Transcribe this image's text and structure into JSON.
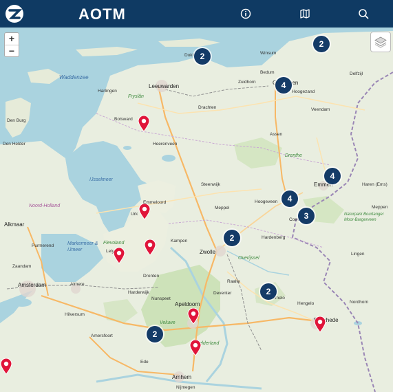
{
  "header": {
    "title": "AOTM",
    "icons": [
      "info-icon",
      "map-icon",
      "search-icon"
    ]
  },
  "map": {
    "zoom_in_label": "+",
    "zoom_out_label": "−",
    "water_labels": [
      "Waddenzee",
      "IJsselmeer",
      "Markermeer & IJmeer",
      "Noord-Holland"
    ],
    "green_labels": [
      "Fryslân",
      "Drenthe",
      "Flevoland",
      "Overijssel",
      "Veluwe",
      "Gelderland",
      "Naturpark Bourtanger Moor-Bargerveen"
    ],
    "place_labels": [
      "Den Burg",
      "Den Helder",
      "Dokkum",
      "Leeuwarden",
      "Harlingen",
      "Bolsward",
      "Heerenveen",
      "Drachten",
      "Groningen",
      "Hoogezand",
      "Veendam",
      "Assen",
      "Emmen",
      "Hoogeveen",
      "Meppel",
      "Steenwijk",
      "Emmeloord",
      "Urk",
      "Lelystad",
      "Dronten",
      "Kampen",
      "Zwolle",
      "Hardenberg",
      "Coevorden",
      "Almelo",
      "Hengelo",
      "Enschede",
      "Deventer",
      "Apeldoorn",
      "Amersfoort",
      "Amsterdam",
      "Almere",
      "Hilversum",
      "Ede",
      "Arnhem",
      "Nijmegen",
      "Harderwijk",
      "Nunspeet",
      "Raalte",
      "Alkmaar",
      "Zaandam",
      "Purmerend",
      "Nordhorn",
      "Haren (Ems)",
      "Lingen",
      "Meppen",
      "Winsum",
      "Bedum",
      "Zuidhorn",
      "Delfzijl"
    ],
    "clusters": [
      {
        "label": "2"
      },
      {
        "label": "2"
      },
      {
        "label": "4"
      },
      {
        "label": "4"
      },
      {
        "label": "4"
      },
      {
        "label": "3"
      },
      {
        "label": "2"
      },
      {
        "label": "2"
      },
      {
        "label": "2"
      }
    ],
    "pin_count": 8
  },
  "colors": {
    "header": "#0f3a63",
    "cluster": "#143b67",
    "pin": "#e0153a",
    "water": "#aad3df",
    "land": "#e9eee0",
    "forest": "#c8dfb2"
  }
}
